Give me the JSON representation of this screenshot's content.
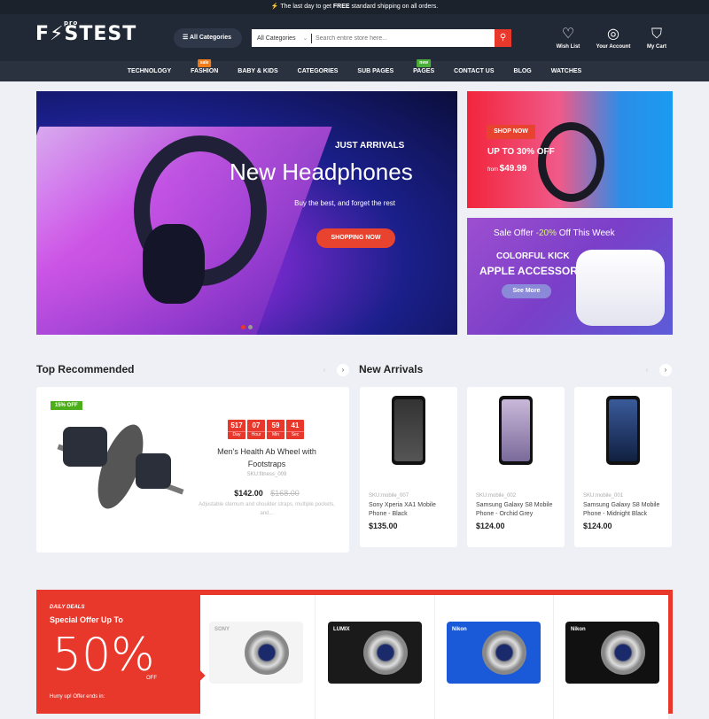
{
  "topbar": {
    "text_pre": "The last day to get ",
    "text_bold": "FREE",
    "text_post": " standard shipping on all orders.",
    "icon": "lightning-icon"
  },
  "header": {
    "logo": "F⚡STEST",
    "logo_sup": "pro",
    "all_categories": "All Categories",
    "search": {
      "category": "All Categories",
      "placeholder": "Search entire store here..."
    },
    "wishlist": "Wish List",
    "account": "Your Account",
    "cart": "My Cart"
  },
  "nav": [
    {
      "label": "TECHNOLOGY"
    },
    {
      "label": "FASHION",
      "badge": "sale",
      "badge_color": "#f07d1a"
    },
    {
      "label": "BABY & KIDS"
    },
    {
      "label": "CATEGORIES"
    },
    {
      "label": "SUB PAGES"
    },
    {
      "label": "PAGES",
      "badge": "new",
      "badge_color": "#4caf3a"
    },
    {
      "label": "CONTACT US"
    },
    {
      "label": "BLOG"
    },
    {
      "label": "WATCHES"
    }
  ],
  "hero": {
    "kicker": "JUST ARRIVALS",
    "title": "New Headphones",
    "subtitle": "Buy the best, and forget the rest",
    "cta": "SHOPPING NOW",
    "slides": 2,
    "active_slide": 1
  },
  "banner1": {
    "cta": "SHOP NOW",
    "headline": "UP TO 30% OFF",
    "from": "from",
    "price": "$49.99"
  },
  "banner2": {
    "offer_pre": "Sale Offer ",
    "offer_pct": "-20%",
    "offer_post": " Off This Week",
    "line1": "COLORFUL KICK",
    "line2": "APPLE ACCESSORIES",
    "cta": "See More"
  },
  "top_recommended": {
    "title": "Top Recommended",
    "product": {
      "badge": "15% OFF",
      "countdown": [
        {
          "value": "517",
          "unit": "Day"
        },
        {
          "value": "07",
          "unit": "Hour"
        },
        {
          "value": "59",
          "unit": "Min"
        },
        {
          "value": "41",
          "unit": "Sec"
        }
      ],
      "name": "Men's Health Ab Wheel with Footstraps",
      "sku": "SKU:fitness_009",
      "price": "$142.00",
      "old_price": "$168.00",
      "description": "Adjustable sternum and shoulder straps, multiple pockets, and..."
    }
  },
  "new_arrivals": {
    "title": "New Arrivals",
    "products": [
      {
        "sku": "SKU:mobile_007",
        "name": "Sony Xperia XA1 Mobile Phone - Black",
        "price": "$135.00"
      },
      {
        "sku": "SKU:mobile_002",
        "name": "Samsung Galaxy S8 Mobile Phone - Orchid Grey",
        "price": "$124.00"
      },
      {
        "sku": "SKU:mobile_001",
        "name": "Samsung Galaxy S8 Mobile Phone - Midnight Black",
        "price": "$124.00"
      }
    ]
  },
  "daily_deals": {
    "kicker": "DAILY DEALS",
    "title": "Special Offer Up To",
    "percent": "50%",
    "off": "OFF",
    "hurry": "Hurry up! Offer ends in:",
    "cameras": [
      "SONY",
      "LUMIX",
      "Nikon",
      "Nikon"
    ]
  },
  "colors": {
    "accent": "#e8382c",
    "header": "#222936",
    "nav": "#2a3240"
  }
}
